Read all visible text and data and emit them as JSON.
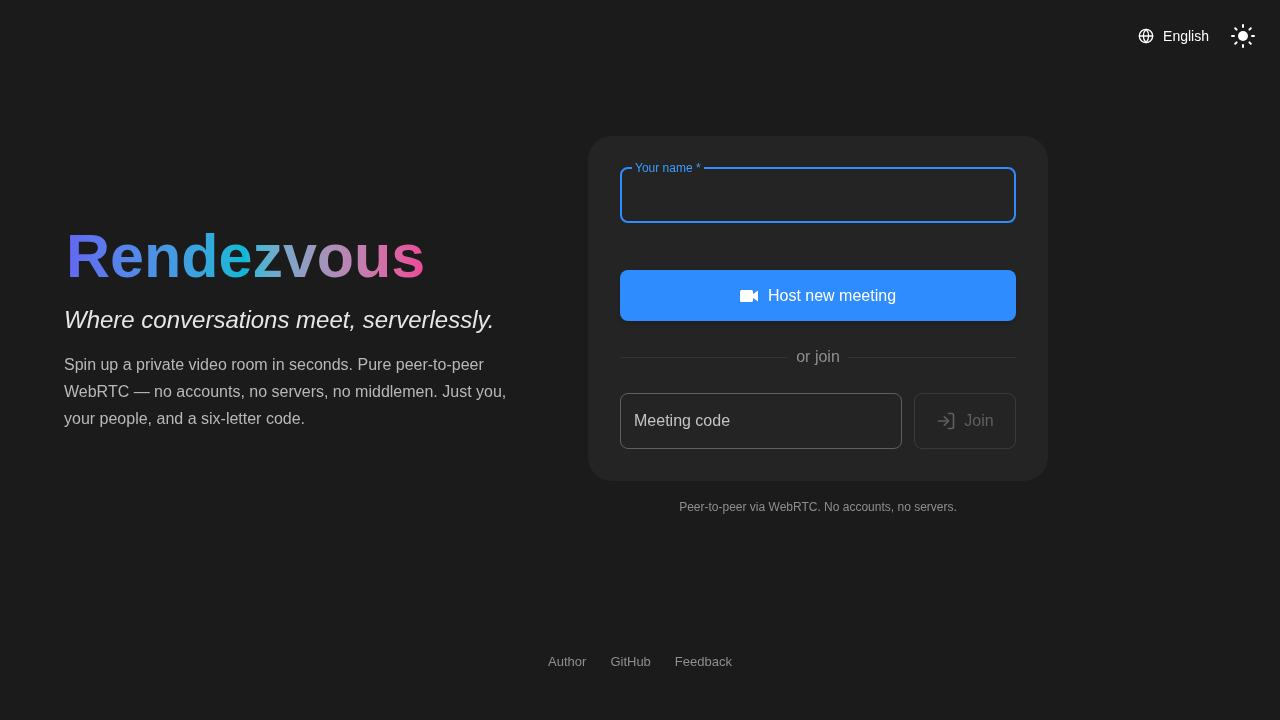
{
  "header": {
    "language": "English"
  },
  "hero": {
    "title": "Rendezvous",
    "tagline": "Where conversations meet, serverlessly.",
    "description": "Spin up a private video room in seconds. Pure peer-to-peer WebRTC — no accounts, no servers, no middlemen. Just you, your people, and a six-letter code."
  },
  "join_card": {
    "name_field": {
      "label": "Your name *",
      "focused": true
    },
    "host_button": {
      "label": "Host new meeting"
    },
    "divider": "or join",
    "code_field": {
      "placeholder": "Meeting code"
    },
    "join_button": {
      "label": "Join",
      "disabled": true
    }
  },
  "note": "Peer-to-peer via WebRTC. No accounts, no servers.",
  "footer": {
    "links": [
      "Author",
      "GitHub",
      "Feedback"
    ]
  }
}
